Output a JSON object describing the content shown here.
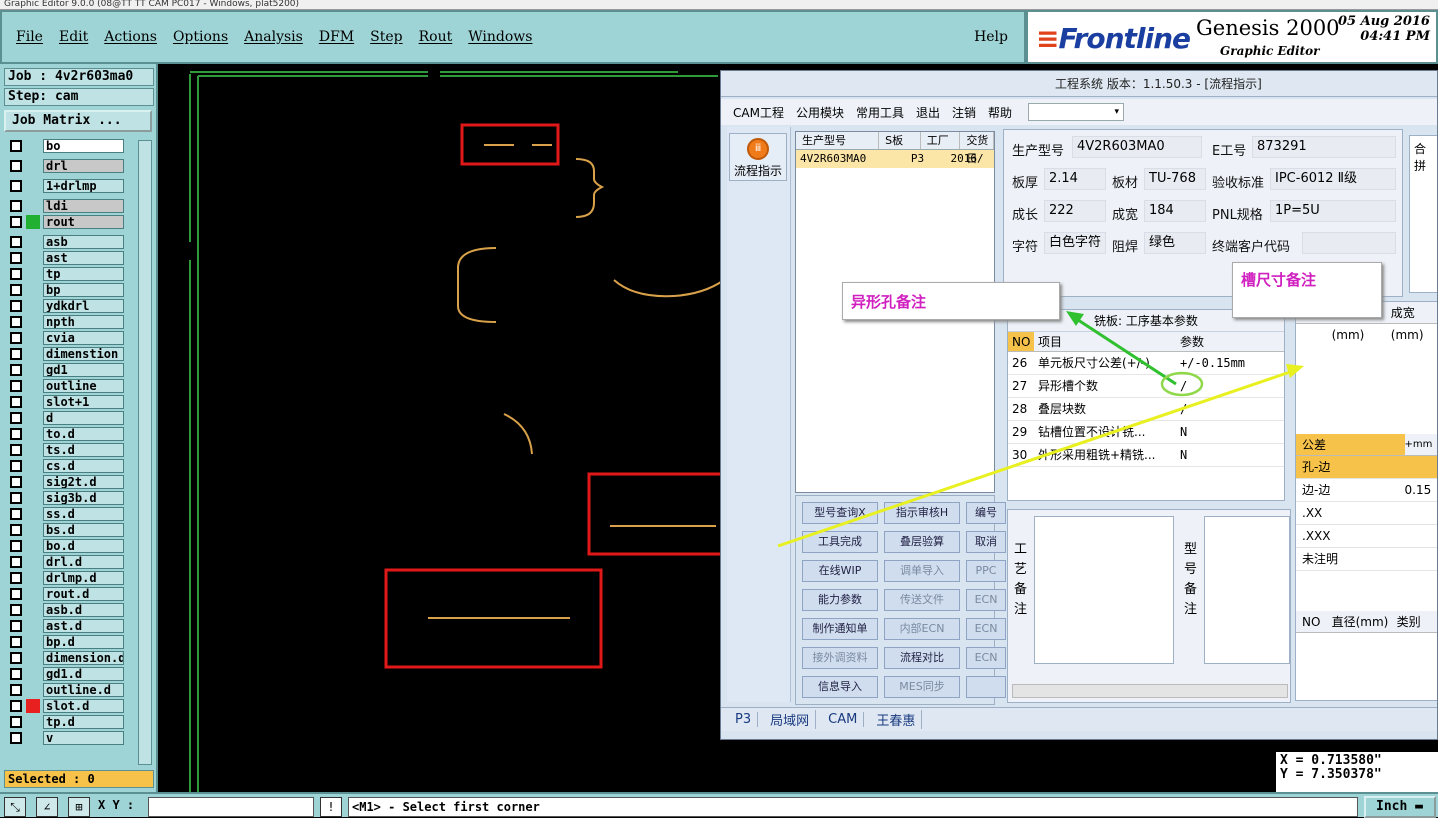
{
  "window_title": "Graphic Editor 9.0.0 (08@TT TT CAM PC017 - Windows, plat5200)",
  "menu": [
    "File",
    "Edit",
    "Actions",
    "Options",
    "Analysis",
    "DFM",
    "Step",
    "Rout",
    "Windows"
  ],
  "help": "Help",
  "brand": {
    "logo": "Frontline",
    "product": "Genesis 2000",
    "subtitle": "Graphic Editor",
    "date": "05 Aug 2016",
    "time": "04:41 PM"
  },
  "job": {
    "job_line": "Job : 4v2r603ma0",
    "step_line": "Step: cam",
    "matrix_button": "Job Matrix ..."
  },
  "layers": [
    {
      "name": "bo",
      "style": "white",
      "swatch": ""
    },
    {
      "name": "drl",
      "style": "grey",
      "swatch": ""
    },
    {
      "name": "1+drlmp",
      "style": "",
      "swatch": ""
    },
    {
      "name": "ldi",
      "style": "grey",
      "swatch": ""
    },
    {
      "name": "rout",
      "style": "grey",
      "swatch": "#22b033"
    },
    {
      "name": "asb",
      "style": "",
      "swatch": ""
    },
    {
      "name": "ast",
      "style": "",
      "swatch": ""
    },
    {
      "name": "tp",
      "style": "",
      "swatch": ""
    },
    {
      "name": "bp",
      "style": "",
      "swatch": ""
    },
    {
      "name": "ydkdrl",
      "style": "",
      "swatch": ""
    },
    {
      "name": "npth",
      "style": "",
      "swatch": ""
    },
    {
      "name": "cvia",
      "style": "",
      "swatch": ""
    },
    {
      "name": "dimenstion",
      "style": "",
      "swatch": ""
    },
    {
      "name": "gd1",
      "style": "",
      "swatch": ""
    },
    {
      "name": "outline",
      "style": "",
      "swatch": ""
    },
    {
      "name": "slot+1",
      "style": "",
      "swatch": ""
    },
    {
      "name": "d",
      "style": "",
      "swatch": ""
    },
    {
      "name": "to.d",
      "style": "",
      "swatch": ""
    },
    {
      "name": "ts.d",
      "style": "",
      "swatch": ""
    },
    {
      "name": "cs.d",
      "style": "",
      "swatch": ""
    },
    {
      "name": "sig2t.d",
      "style": "",
      "swatch": ""
    },
    {
      "name": "sig3b.d",
      "style": "",
      "swatch": ""
    },
    {
      "name": "ss.d",
      "style": "",
      "swatch": ""
    },
    {
      "name": "bs.d",
      "style": "",
      "swatch": ""
    },
    {
      "name": "bo.d",
      "style": "",
      "swatch": ""
    },
    {
      "name": "drl.d",
      "style": "",
      "swatch": ""
    },
    {
      "name": "drlmp.d",
      "style": "",
      "swatch": ""
    },
    {
      "name": "rout.d",
      "style": "",
      "swatch": ""
    },
    {
      "name": "asb.d",
      "style": "",
      "swatch": ""
    },
    {
      "name": "ast.d",
      "style": "",
      "swatch": ""
    },
    {
      "name": "bp.d",
      "style": "",
      "swatch": ""
    },
    {
      "name": "dimension.d",
      "style": "",
      "swatch": ""
    },
    {
      "name": "gd1.d",
      "style": "",
      "swatch": ""
    },
    {
      "name": "outline.d",
      "style": "",
      "swatch": ""
    },
    {
      "name": "slot.d",
      "style": "",
      "swatch": "#e82020"
    },
    {
      "name": "tp.d",
      "style": "",
      "swatch": ""
    },
    {
      "name": "v",
      "style": "",
      "swatch": ""
    }
  ],
  "selected": "Selected : 0",
  "coords": {
    "x": "X = 0.713580\"",
    "y": "Y = 7.350378\""
  },
  "status": {
    "xy_label": "X Y :",
    "message": "<M1> - Select first corner",
    "unit": "Inch"
  },
  "dialog": {
    "title": "工程系统  版本：1.1.50.3 - [流程指示]",
    "menu": [
      "CAM工程",
      "公用模块",
      "常用工具",
      "退出",
      "注销",
      "帮助"
    ],
    "flow_button": "流程指示",
    "grid_headers": [
      "生产型号",
      "S板",
      "工厂",
      "交货日"
    ],
    "grid_row": [
      "4V2R603MA0",
      "P3",
      "2016/"
    ],
    "buttons": [
      {
        "label": "型号查询X",
        "dis": false
      },
      {
        "label": "指示审核H",
        "dis": false
      },
      {
        "label": "编号",
        "dis": false
      },
      {
        "label": "工具完成",
        "dis": false
      },
      {
        "label": "叠层验算",
        "dis": false
      },
      {
        "label": "取消",
        "dis": false
      },
      {
        "label": "在线WIP",
        "dis": false
      },
      {
        "label": "调单导入",
        "dis": true
      },
      {
        "label": "PPC",
        "dis": true
      },
      {
        "label": "能力参数",
        "dis": false
      },
      {
        "label": "传送文件",
        "dis": true
      },
      {
        "label": "ECN",
        "dis": true
      },
      {
        "label": "制作通知单",
        "dis": false
      },
      {
        "label": "内部ECN",
        "dis": true
      },
      {
        "label": "ECN",
        "dis": true
      },
      {
        "label": "接外调资料",
        "dis": true
      },
      {
        "label": "流程对比",
        "dis": false
      },
      {
        "label": "ECN",
        "dis": true
      },
      {
        "label": "信息导入",
        "dis": false
      },
      {
        "label": "MES同步",
        "dis": true
      },
      {
        "label": "",
        "dis": false
      }
    ],
    "tabs": [
      "P3",
      "局域网",
      "CAM",
      "王春惠"
    ],
    "info": {
      "型号_label": "生产型号",
      "型号": "4V2R603MA0",
      "e_label": "E工号",
      "e": "873291",
      "厚_label": "板厚",
      "厚": "2.14",
      "材_label": "板材",
      "材": "TU-768",
      "验_label": "验收标准",
      "验": "IPC-6012 Ⅱ级",
      "长_label": "成长",
      "长": "222",
      "宽_label": "成宽",
      "宽": "184",
      "pnl_label": "PNL规格",
      "pnl": "1P=5U",
      "字_label": "字符",
      "字": "白色字符",
      "焊_label": "阻焊",
      "焊": "绿色",
      "终_label": "终端客户代码"
    },
    "right_info": "合拼",
    "params_title": "铣板: 工序基本参数",
    "params_headers": [
      "NO",
      "项目",
      "参数"
    ],
    "params": [
      {
        "no": "26",
        "item": "单元板尺寸公差(+/-)",
        "val": "+/-0.15mm"
      },
      {
        "no": "27",
        "item": "异形槽个数",
        "val": "/"
      },
      {
        "no": "28",
        "item": "叠层块数",
        "val": "/"
      },
      {
        "no": "29",
        "item": "钻槽位置不设计铣...",
        "val": "N"
      },
      {
        "no": "30",
        "item": "外形采用粗铣+精铣...",
        "val": "N"
      }
    ],
    "remarks": {
      "left_label": "工艺备注",
      "right_label": "型号备注"
    },
    "right_grid_headers": [
      "NO",
      "成长(mm)",
      "成宽(mm)"
    ],
    "tolerance_header": [
      "公差",
      "+mm"
    ],
    "tolerance_rows": [
      [
        "孔-边",
        ""
      ],
      [
        "边-边",
        "0.15"
      ],
      [
        ".XX",
        ""
      ],
      [
        ".XXX",
        ""
      ],
      [
        "未注明",
        ""
      ]
    ],
    "drill_headers": [
      "NO",
      "直径(mm)",
      "类别"
    ]
  },
  "callouts": {
    "left": "异形孔备注",
    "right": "槽尺寸备注"
  }
}
